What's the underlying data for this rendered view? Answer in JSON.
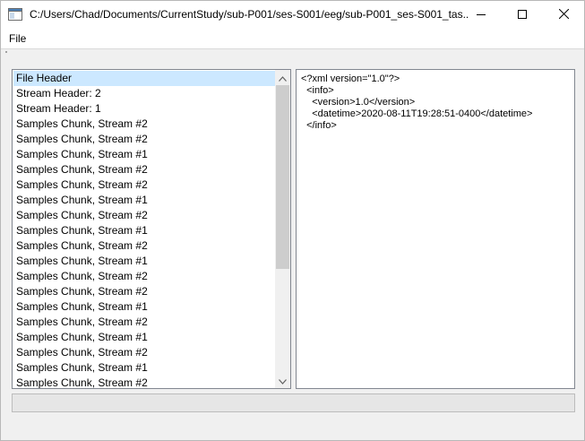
{
  "window": {
    "title": "C:/Users/Chad/Documents/CurrentStudy/sub-P001/ses-S001/eeg/sub-P001_ses-S001_tas..."
  },
  "menu": {
    "file_label": "File"
  },
  "chunk_list": {
    "selected_index": 0,
    "items": [
      "File Header",
      "Stream Header: 2",
      "Stream Header: 1",
      "Samples Chunk, Stream #2",
      "Samples Chunk, Stream #2",
      "Samples Chunk, Stream #1",
      "Samples Chunk, Stream #2",
      "Samples Chunk, Stream #2",
      "Samples Chunk, Stream #1",
      "Samples Chunk, Stream #2",
      "Samples Chunk, Stream #1",
      "Samples Chunk, Stream #2",
      "Samples Chunk, Stream #1",
      "Samples Chunk, Stream #2",
      "Samples Chunk, Stream #2",
      "Samples Chunk, Stream #1",
      "Samples Chunk, Stream #2",
      "Samples Chunk, Stream #1",
      "Samples Chunk, Stream #2",
      "Samples Chunk, Stream #1",
      "Samples Chunk, Stream #2"
    ]
  },
  "xml_view": {
    "lines": [
      "<?xml version=\"1.0\"?>",
      "  <info>",
      "    <version>1.0</version>",
      "    <datetime>2020-08-11T19:28:51-0400</datetime>",
      "  </info>"
    ]
  },
  "icons": {
    "app": "window-app-icon",
    "minimize": "minimize-icon",
    "maximize": "maximize-icon",
    "close": "close-icon",
    "scroll_up": "chevron-up-icon",
    "scroll_down": "chevron-down-icon"
  },
  "colors": {
    "selection": "#cce8ff",
    "panel_border": "#828790"
  }
}
